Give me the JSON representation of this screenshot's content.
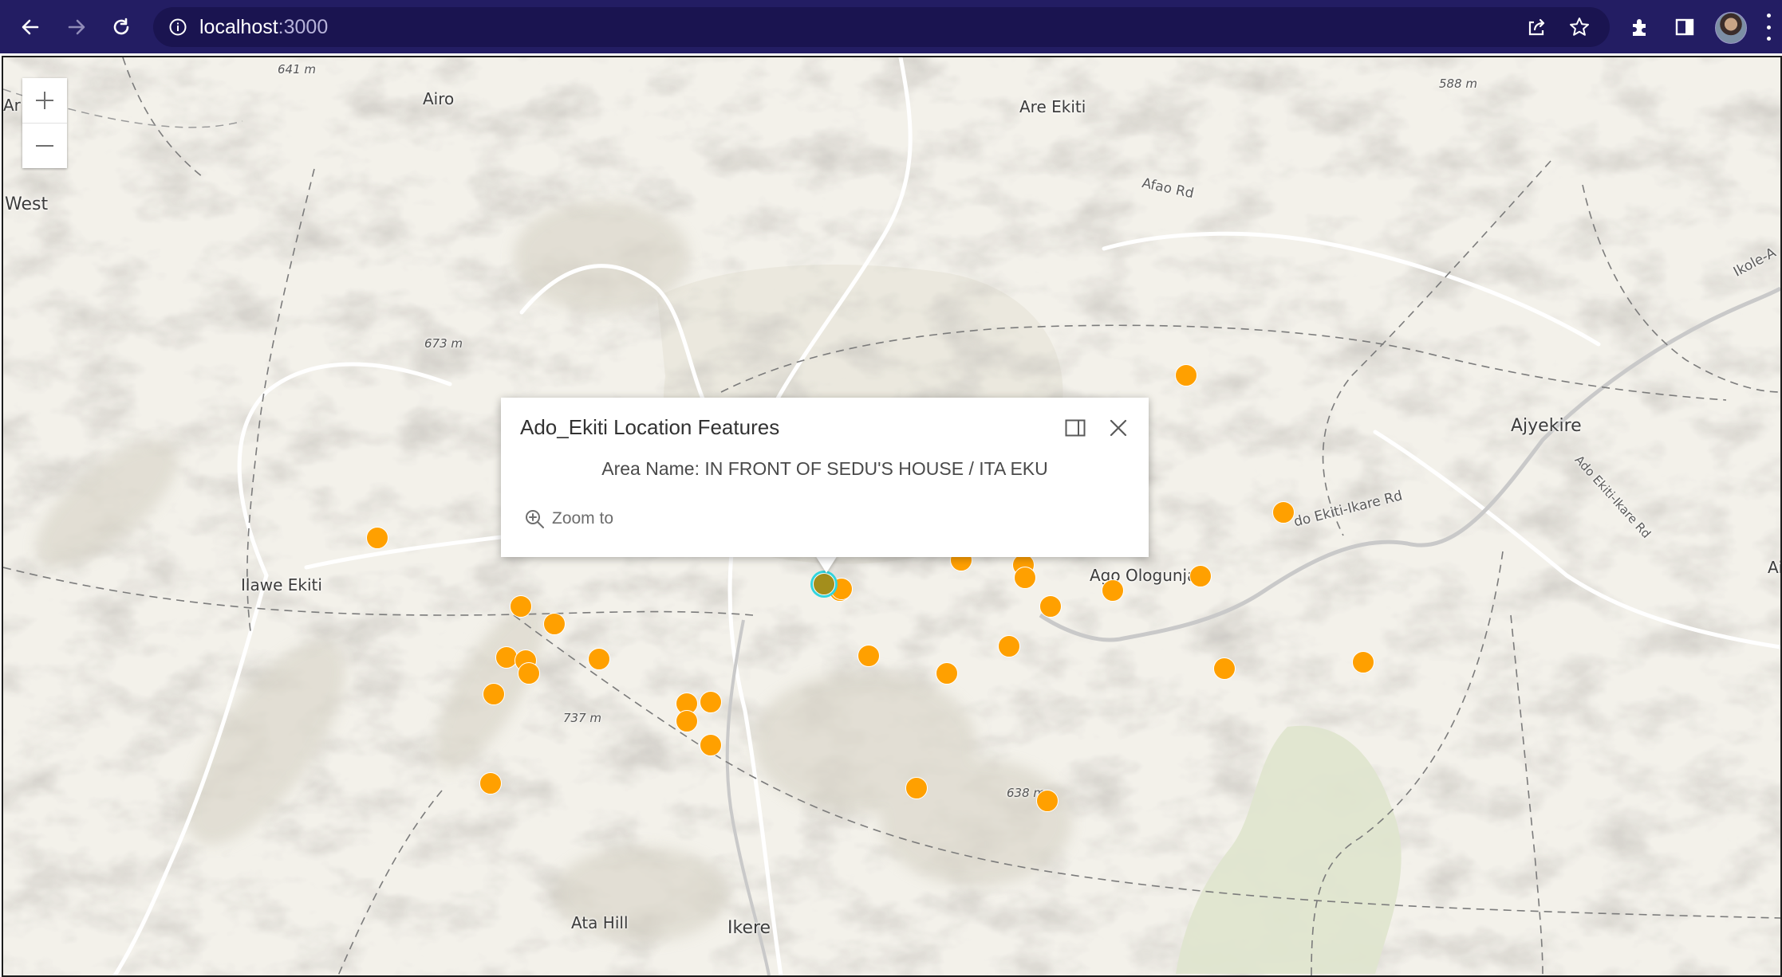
{
  "browser": {
    "url_host": "localhost",
    "url_port": ":3000",
    "icons": [
      "back-arrow-icon",
      "forward-arrow-icon",
      "reload-icon",
      "info-icon",
      "share-icon",
      "star-icon",
      "extensions-icon",
      "side-panel-icon",
      "profile-avatar",
      "menu-dots-icon"
    ],
    "accent_color": "#231d63"
  },
  "map": {
    "zoom_in_label": "+",
    "zoom_out_label": "—",
    "places": {
      "airo": "Airo",
      "are_ekiti": "Are Ekiti",
      "west": "West",
      "ar": "Ar",
      "ilawe_ekiti": "Ilawe Ekiti",
      "ajyekire": "Ajyekire",
      "ago_ologunja": "Ago Ologunja",
      "ikere": "Ikere",
      "ata_hill": "Ata Hill",
      "ai": "Ai"
    },
    "elevations": {
      "e641": "641 m",
      "e588": "588 m",
      "e673": "673 m",
      "e737": "737 m",
      "e638": "638 m"
    },
    "roads": {
      "afao_rd": "Afao Rd",
      "ikole": "Ikole-A",
      "ado_ikare_1": "do Ekiti-Ikare Rd",
      "ado_ikare_2": "Ado Ekiti-Ikare Rd"
    },
    "marker_color": "#ffa000",
    "selected_marker_color": "#a38e1c",
    "selection_ring_color": "#33d4dd"
  },
  "popup": {
    "title": "Ado_Ekiti Location Features",
    "field_label": "Area Name:",
    "field_value": "IN FRONT OF SEDU'S HOUSE / ITA EKU",
    "zoom_to_label": "Zoom to"
  }
}
